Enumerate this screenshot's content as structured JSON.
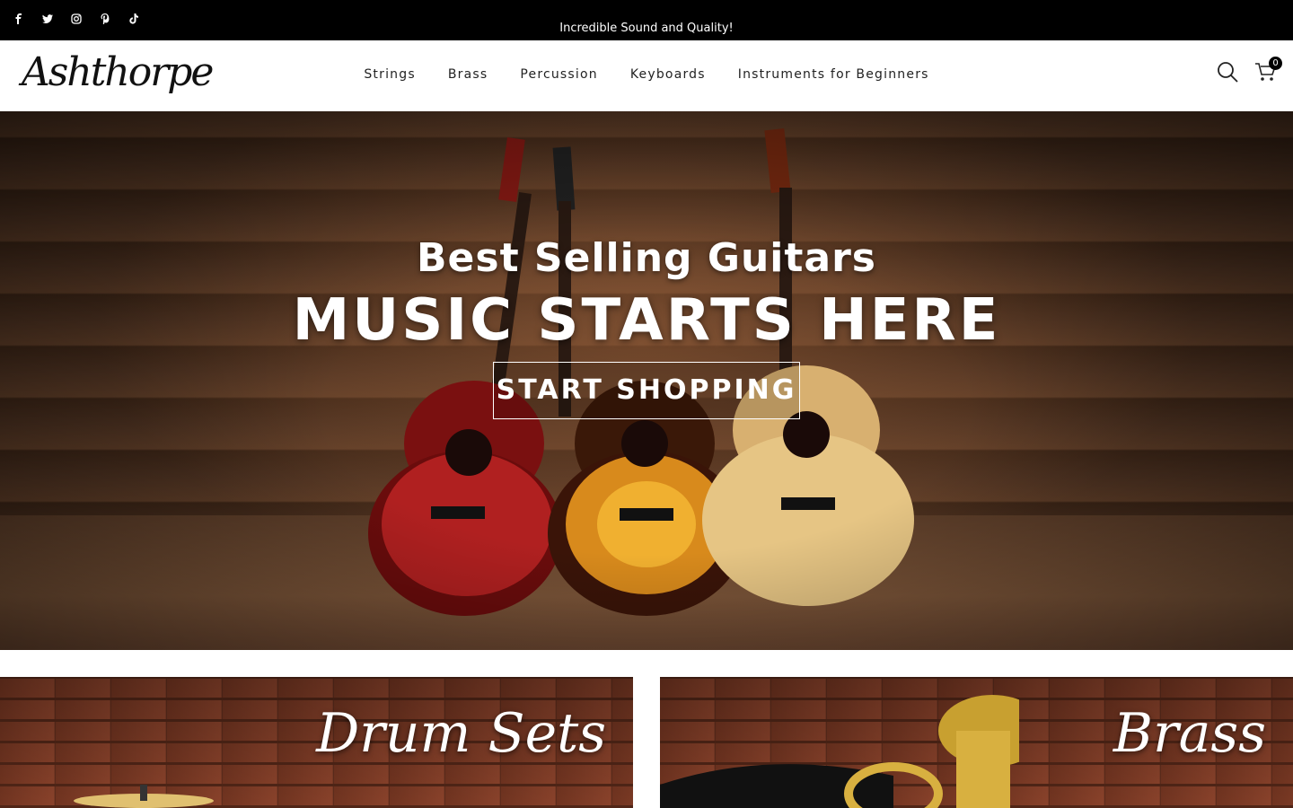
{
  "topbar": {
    "announcement": "Incredible Sound and Quality!",
    "socials": [
      "facebook-icon",
      "twitter-icon",
      "instagram-icon",
      "pinterest-icon",
      "tiktok-icon"
    ]
  },
  "header": {
    "logo_text": "Ashthorpe",
    "nav": [
      {
        "label": "Strings"
      },
      {
        "label": "Brass"
      },
      {
        "label": "Percussion"
      },
      {
        "label": "Keyboards"
      },
      {
        "label": "Instruments for Beginners"
      }
    ],
    "cart_count": "0"
  },
  "hero": {
    "subtitle": "Best Selling Guitars",
    "title": "MUSIC STARTS HERE",
    "cta_label": "START SHOPPING"
  },
  "collections": [
    {
      "label": "Drum Sets"
    },
    {
      "label": "Brass"
    }
  ]
}
